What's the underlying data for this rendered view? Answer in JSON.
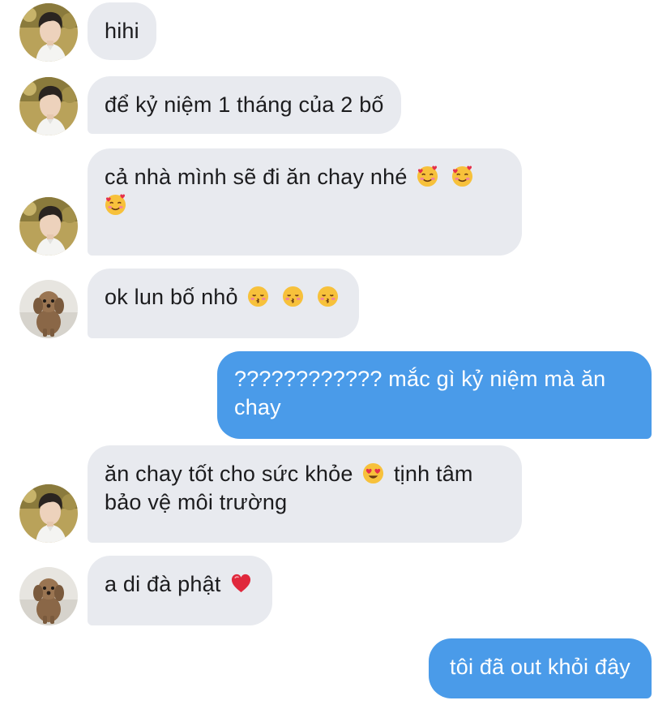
{
  "messages": [
    {
      "sender": "boy",
      "text": "hihi",
      "emojis": []
    },
    {
      "sender": "boy",
      "text": "để kỷ niệm 1 tháng của 2 bố",
      "emojis": []
    },
    {
      "sender": "boy",
      "text": "cả nhà mình sẽ đi ăn chay nhé",
      "emojis": [
        "smiling-face-with-hearts-icon",
        "smiling-face-with-hearts-icon",
        "smiling-face-with-hearts-icon"
      ]
    },
    {
      "sender": "dog",
      "text": "ok lun bố nhỏ",
      "emojis": [
        "kissing-face-icon",
        "kissing-face-icon",
        "kissing-face-icon"
      ]
    },
    {
      "sender": "me",
      "text": "???????????? mắc gì kỷ niệm mà ăn chay",
      "emojis": []
    },
    {
      "sender": "boy",
      "text_before": "ăn chay tốt cho sức khỏe",
      "text_after": "tịnh tâm",
      "text_line2": "bảo vệ môi trường",
      "emojis": [
        "heart-eyes-icon"
      ]
    },
    {
      "sender": "dog",
      "text": "a di đà phật",
      "emojis": [
        "red-heart-icon"
      ]
    },
    {
      "sender": "me",
      "text": "tôi đã out khỏi đây",
      "emojis": []
    }
  ],
  "colors": {
    "incoming_bubble": "#e8eaef",
    "outgoing_bubble": "#4a9be9",
    "incoming_text": "#1c1c1e",
    "outgoing_text": "#ffffff"
  }
}
